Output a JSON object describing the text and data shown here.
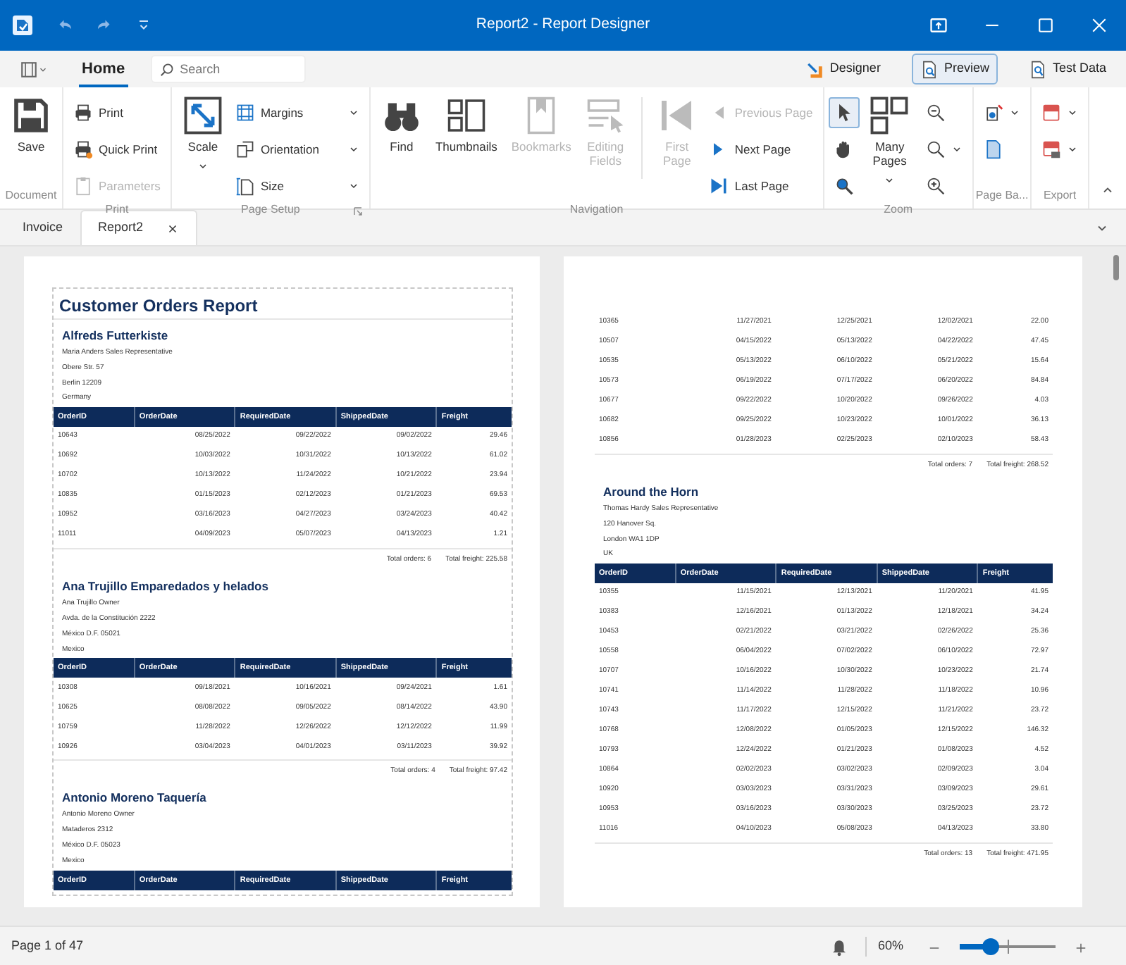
{
  "window": {
    "title": "Report2 - Report Designer"
  },
  "ribbon_tabs": [
    {
      "label": "Home",
      "selected": true
    }
  ],
  "search": {
    "placeholder": "Search"
  },
  "view_modes": [
    {
      "label": "Designer",
      "selected": false
    },
    {
      "label": "Preview",
      "selected": true
    },
    {
      "label": "Test Data",
      "selected": false
    }
  ],
  "ribbon": {
    "groups": [
      {
        "title": "Document",
        "launcher": false,
        "items": [
          {
            "kind": "large",
            "label": "Save",
            "disabled": false,
            "dropdown": false
          }
        ]
      },
      {
        "title": "Print",
        "launcher": false,
        "items": [
          {
            "kind": "small",
            "label": "Print",
            "disabled": false,
            "dropdown": false
          },
          {
            "kind": "small",
            "label": "Quick Print",
            "disabled": false,
            "dropdown": false
          },
          {
            "kind": "small",
            "label": "Parameters",
            "disabled": true,
            "dropdown": false
          }
        ]
      },
      {
        "title": "Page Setup",
        "launcher": true,
        "items": [
          {
            "kind": "large",
            "label": "Scale",
            "disabled": false,
            "dropdown": true
          },
          {
            "kind": "small",
            "label": "Margins",
            "disabled": false,
            "dropdown": true
          },
          {
            "kind": "small",
            "label": "Orientation",
            "disabled": false,
            "dropdown": true
          },
          {
            "kind": "small",
            "label": "Size",
            "disabled": false,
            "dropdown": true
          }
        ]
      },
      {
        "title": "Navigation",
        "launcher": false,
        "items": [
          {
            "kind": "large",
            "label": "Find",
            "disabled": false,
            "dropdown": false
          },
          {
            "kind": "large",
            "label": "Thumbnails",
            "disabled": false,
            "dropdown": false
          },
          {
            "kind": "large",
            "label": "Bookmarks",
            "disabled": true,
            "dropdown": false
          },
          {
            "kind": "large",
            "label": "Editing Fields",
            "disabled": true,
            "dropdown": false
          },
          {
            "kind": "separator"
          },
          {
            "kind": "large",
            "label": "First Page",
            "disabled": true,
            "dropdown": false
          },
          {
            "kind": "small",
            "label": "Previous Page",
            "disabled": true,
            "dropdown": false
          },
          {
            "kind": "small",
            "label": "Next  Page",
            "disabled": false,
            "dropdown": false
          },
          {
            "kind": "small",
            "label": "Last  Page",
            "disabled": false,
            "dropdown": false
          }
        ]
      },
      {
        "title": "Zoom",
        "launcher": false,
        "items": [
          {
            "kind": "tool",
            "selected": true,
            "disabled": false,
            "dropdown": false
          },
          {
            "kind": "tool",
            "selected": false,
            "disabled": false,
            "dropdown": false
          },
          {
            "kind": "tool",
            "selected": false,
            "disabled": false,
            "dropdown": false
          },
          {
            "kind": "large",
            "label": "Many Pages",
            "disabled": false,
            "dropdown": true
          },
          {
            "kind": "tool",
            "selected": false,
            "disabled": false,
            "dropdown": false
          },
          {
            "kind": "tool",
            "selected": false,
            "disabled": false,
            "dropdown": true
          },
          {
            "kind": "tool",
            "selected": false,
            "disabled": false,
            "dropdown": false
          }
        ]
      },
      {
        "title": "Page Ba...",
        "launcher": false,
        "items": [
          {
            "kind": "tool",
            "selected": false,
            "disabled": false,
            "dropdown": true
          },
          {
            "kind": "tool",
            "selected": false,
            "disabled": false,
            "dropdown": false
          }
        ]
      },
      {
        "title": "Export",
        "launcher": false,
        "items": [
          {
            "kind": "tool",
            "selected": false,
            "disabled": false,
            "dropdown": true
          },
          {
            "kind": "tool",
            "selected": false,
            "disabled": false,
            "dropdown": true
          }
        ]
      }
    ]
  },
  "document_tabs": [
    {
      "label": "Invoice",
      "selected": false,
      "closable": false
    },
    {
      "label": "Report2",
      "selected": true,
      "closable": true
    }
  ],
  "pages": [
    {
      "title": "Customer Orders Report",
      "blocks": [
        {
          "kind": "customer",
          "name": "Alfreds Futterkiste",
          "lines": [
            "Maria  Anders  Sales Representative",
            "Obere Str. 57",
            "Berlin 12209",
            "Germany"
          ]
        },
        {
          "kind": "table",
          "columns": [
            "OrderID",
            "OrderDate",
            "RequiredDate",
            "ShippedDate",
            "Freight"
          ],
          "rows": [
            [
              "10643",
              "08/25/2022",
              "09/22/2022",
              "09/02/2022",
              "29.46"
            ],
            [
              "10692",
              "10/03/2022",
              "10/31/2022",
              "10/13/2022",
              "61.02"
            ],
            [
              "10702",
              "10/13/2022",
              "11/24/2022",
              "10/21/2022",
              "23.94"
            ],
            [
              "10835",
              "01/15/2023",
              "02/12/2023",
              "01/21/2023",
              "69.53"
            ],
            [
              "10952",
              "03/16/2023",
              "04/27/2023",
              "03/24/2023",
              "40.42"
            ],
            [
              "11011",
              "04/09/2023",
              "05/07/2023",
              "04/13/2023",
              "1.21"
            ]
          ]
        },
        {
          "kind": "totals",
          "orders": "Total orders: 6",
          "freight": "Total freight: 225.58"
        },
        {
          "kind": "customer",
          "name": "Ana Trujillo Emparedados y helados",
          "lines": [
            "Ana  Trujillo  Owner",
            "Avda. de la Constitución 2222",
            "México D.F. 05021",
            "Mexico"
          ]
        },
        {
          "kind": "table",
          "columns": [
            "OrderID",
            "OrderDate",
            "RequiredDate",
            "ShippedDate",
            "Freight"
          ],
          "rows": [
            [
              "10308",
              "09/18/2021",
              "10/16/2021",
              "09/24/2021",
              "1.61"
            ],
            [
              "10625",
              "08/08/2022",
              "09/05/2022",
              "08/14/2022",
              "43.90"
            ],
            [
              "10759",
              "11/28/2022",
              "12/26/2022",
              "12/12/2022",
              "11.99"
            ],
            [
              "10926",
              "03/04/2023",
              "04/01/2023",
              "03/11/2023",
              "39.92"
            ]
          ]
        },
        {
          "kind": "totals",
          "orders": "Total orders: 4",
          "freight": "Total freight: 97.42"
        },
        {
          "kind": "customer",
          "name": "Antonio Moreno Taquería",
          "lines": [
            "Antonio  Moreno  Owner",
            "Mataderos  2312",
            "México D.F. 05023",
            "Mexico"
          ]
        },
        {
          "kind": "table",
          "columns": [
            "OrderID",
            "OrderDate",
            "RequiredDate",
            "ShippedDate",
            "Freight"
          ]
        }
      ]
    },
    {
      "blocks": [
        {
          "kind": "table",
          "rows": [
            [
              "10365",
              "11/27/2021",
              "12/25/2021",
              "12/02/2021",
              "22.00"
            ],
            [
              "10507",
              "04/15/2022",
              "05/13/2022",
              "04/22/2022",
              "47.45"
            ],
            [
              "10535",
              "05/13/2022",
              "06/10/2022",
              "05/21/2022",
              "15.64"
            ],
            [
              "10573",
              "06/19/2022",
              "07/17/2022",
              "06/20/2022",
              "84.84"
            ],
            [
              "10677",
              "09/22/2022",
              "10/20/2022",
              "09/26/2022",
              "4.03"
            ],
            [
              "10682",
              "09/25/2022",
              "10/23/2022",
              "10/01/2022",
              "36.13"
            ],
            [
              "10856",
              "01/28/2023",
              "02/25/2023",
              "02/10/2023",
              "58.43"
            ]
          ]
        },
        {
          "kind": "totals",
          "orders": "Total orders: 7",
          "freight": "Total freight: 268.52"
        },
        {
          "kind": "customer",
          "name": "Around the Horn",
          "lines": [
            "Thomas  Hardy  Sales Representative",
            "120 Hanover Sq.",
            "London WA1 1DP",
            "UK"
          ]
        },
        {
          "kind": "table",
          "columns": [
            "OrderID",
            "OrderDate",
            "RequiredDate",
            "ShippedDate",
            "Freight"
          ],
          "rows": [
            [
              "10355",
              "11/15/2021",
              "12/13/2021",
              "11/20/2021",
              "41.95"
            ],
            [
              "10383",
              "12/16/2021",
              "01/13/2022",
              "12/18/2021",
              "34.24"
            ],
            [
              "10453",
              "02/21/2022",
              "03/21/2022",
              "02/26/2022",
              "25.36"
            ],
            [
              "10558",
              "06/04/2022",
              "07/02/2022",
              "06/10/2022",
              "72.97"
            ],
            [
              "10707",
              "10/16/2022",
              "10/30/2022",
              "10/23/2022",
              "21.74"
            ],
            [
              "10741",
              "11/14/2022",
              "11/28/2022",
              "11/18/2022",
              "10.96"
            ],
            [
              "10743",
              "11/17/2022",
              "12/15/2022",
              "11/21/2022",
              "23.72"
            ],
            [
              "10768",
              "12/08/2022",
              "01/05/2023",
              "12/15/2022",
              "146.32"
            ],
            [
              "10793",
              "12/24/2022",
              "01/21/2023",
              "01/08/2023",
              "4.52"
            ],
            [
              "10864",
              "02/02/2023",
              "03/02/2023",
              "02/09/2023",
              "3.04"
            ],
            [
              "10920",
              "03/03/2023",
              "03/31/2023",
              "03/09/2023",
              "29.61"
            ],
            [
              "10953",
              "03/16/2023",
              "03/30/2023",
              "03/25/2023",
              "23.72"
            ],
            [
              "11016",
              "04/10/2023",
              "05/08/2023",
              "04/13/2023",
              "33.80"
            ]
          ]
        },
        {
          "kind": "totals",
          "orders": "Total orders: 13",
          "freight": "Total freight: 471.95"
        }
      ]
    }
  ],
  "status_bar": {
    "page": "Page 1 of 47",
    "zoom": "60%",
    "level": 0.33
  }
}
